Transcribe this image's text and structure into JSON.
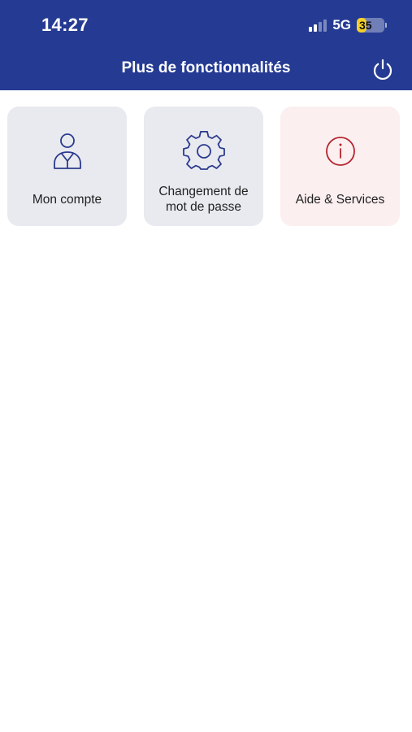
{
  "status_bar": {
    "time": "14:27",
    "network": "5G",
    "battery_level": "35",
    "signal_bars_active": 2,
    "signal_bars_total": 4
  },
  "header": {
    "title": "Plus de fonctionnalités",
    "background_color": "#253b93",
    "power_icon": "power-icon"
  },
  "tiles": [
    {
      "label": "Mon compte",
      "icon": "user-icon",
      "background_color": "#e8eaf0",
      "icon_color": "#2b3a8c"
    },
    {
      "label": "Changement de mot de passe",
      "icon": "gear-icon",
      "background_color": "#e8eaf0",
      "icon_color": "#2b3a8c"
    },
    {
      "label": "Aide & Services",
      "icon": "info-icon",
      "background_color": "#fbeff0",
      "icon_color": "#b3242e"
    }
  ]
}
